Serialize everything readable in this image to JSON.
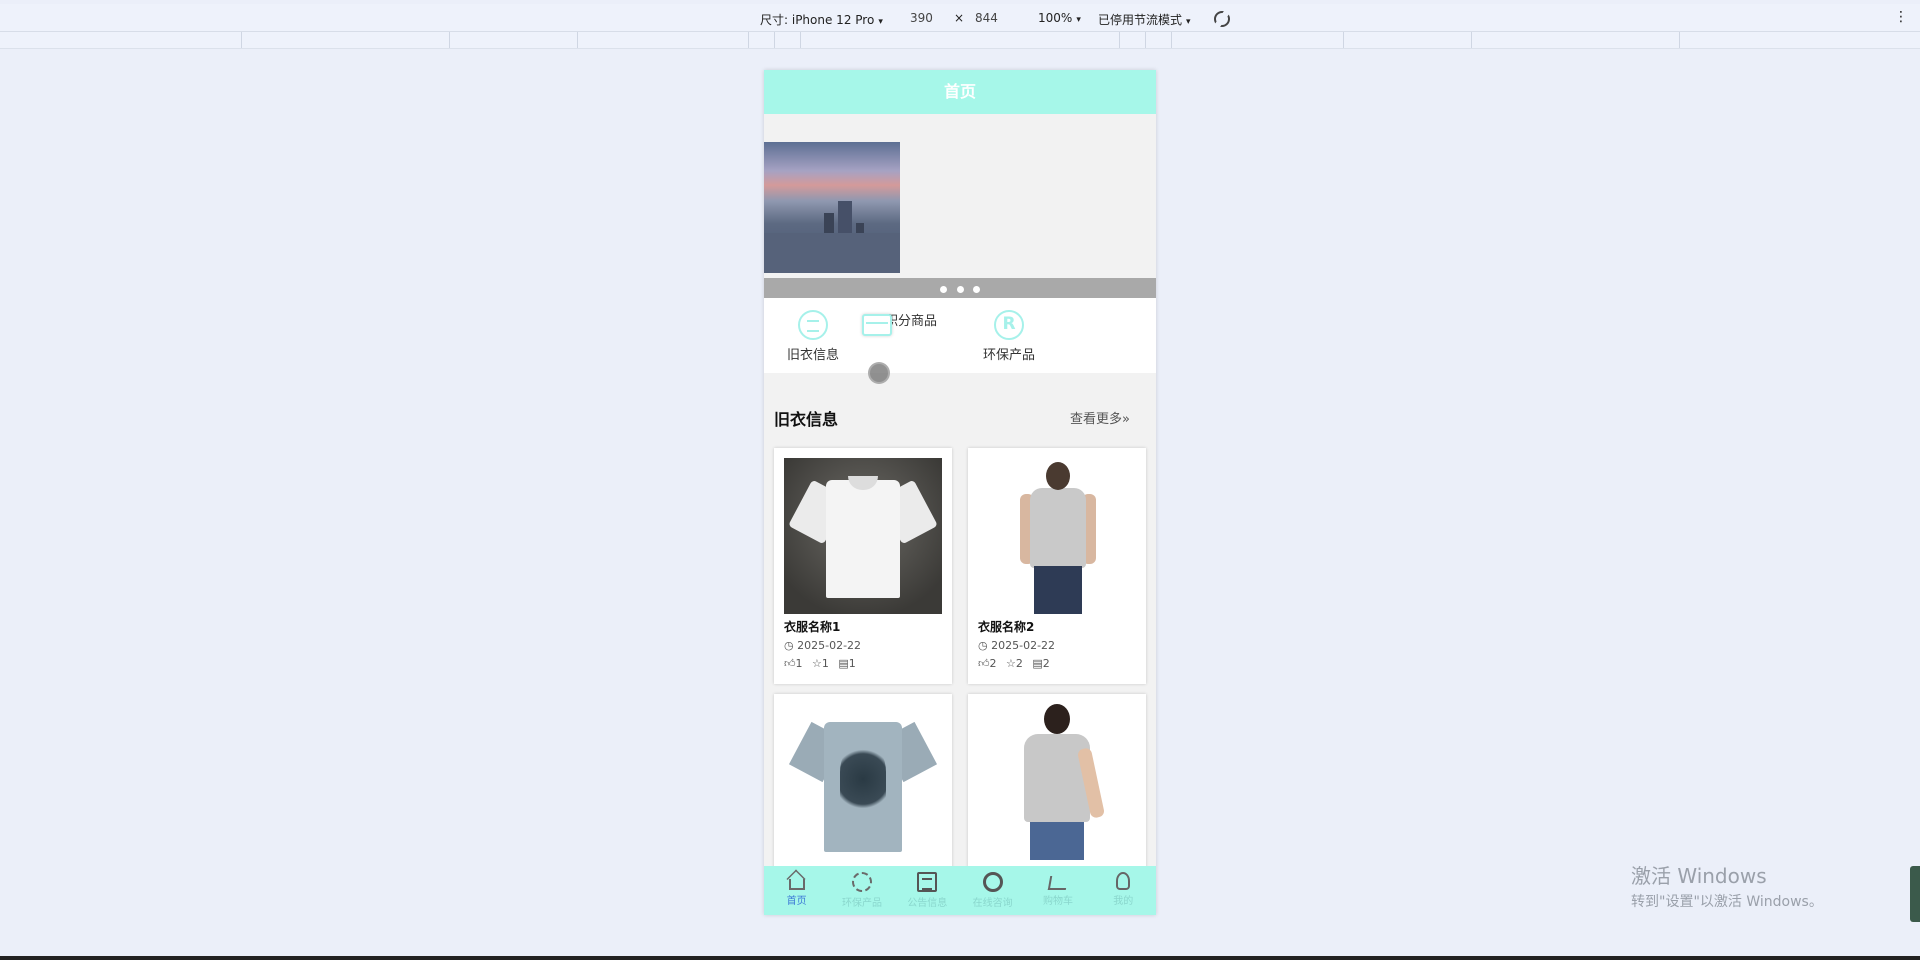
{
  "devtools": {
    "device_label": "尺寸: iPhone 12 Pro",
    "width": "390",
    "times": "×",
    "height": "844",
    "zoom": "100%",
    "throttle": "已停用节流模式",
    "more": "⋮",
    "caret": "▾"
  },
  "page": {
    "title": "首页"
  },
  "banner": {
    "dot_count": 3,
    "active_index": 0
  },
  "quick_nav": [
    {
      "label": "旧衣信息",
      "icon": "list-circle-icon"
    },
    {
      "label": "积分商品",
      "icon": "card-icon"
    },
    {
      "label": "环保产品",
      "icon": "registered-icon"
    }
  ],
  "section": {
    "title": "旧衣信息",
    "more": "查看更多»"
  },
  "items": [
    {
      "name": "衣服名称1",
      "date": "2025-02-22",
      "likes": "1",
      "favorites": "1",
      "comments": "1"
    },
    {
      "name": "衣服名称2",
      "date": "2025-02-22",
      "likes": "2",
      "favorites": "2",
      "comments": "2"
    },
    {
      "name": "",
      "date": "",
      "likes": "",
      "favorites": "",
      "comments": ""
    },
    {
      "name": "",
      "date": "",
      "likes": "",
      "favorites": "",
      "comments": ""
    }
  ],
  "tabbar": [
    {
      "label": "首页",
      "active": true
    },
    {
      "label": "环保产品",
      "active": false
    },
    {
      "label": "公告信息",
      "active": false
    },
    {
      "label": "在线咨询",
      "active": false
    },
    {
      "label": "购物车",
      "active": false
    },
    {
      "label": "我的",
      "active": false
    }
  ],
  "colors": {
    "header": "#a6f7e9",
    "accent": "#a6f1ea",
    "tab_active": "#3e7bd6"
  },
  "watermark": {
    "line1": "激活 Windows",
    "line2": "转到\"设置\"以激活 Windows。"
  }
}
